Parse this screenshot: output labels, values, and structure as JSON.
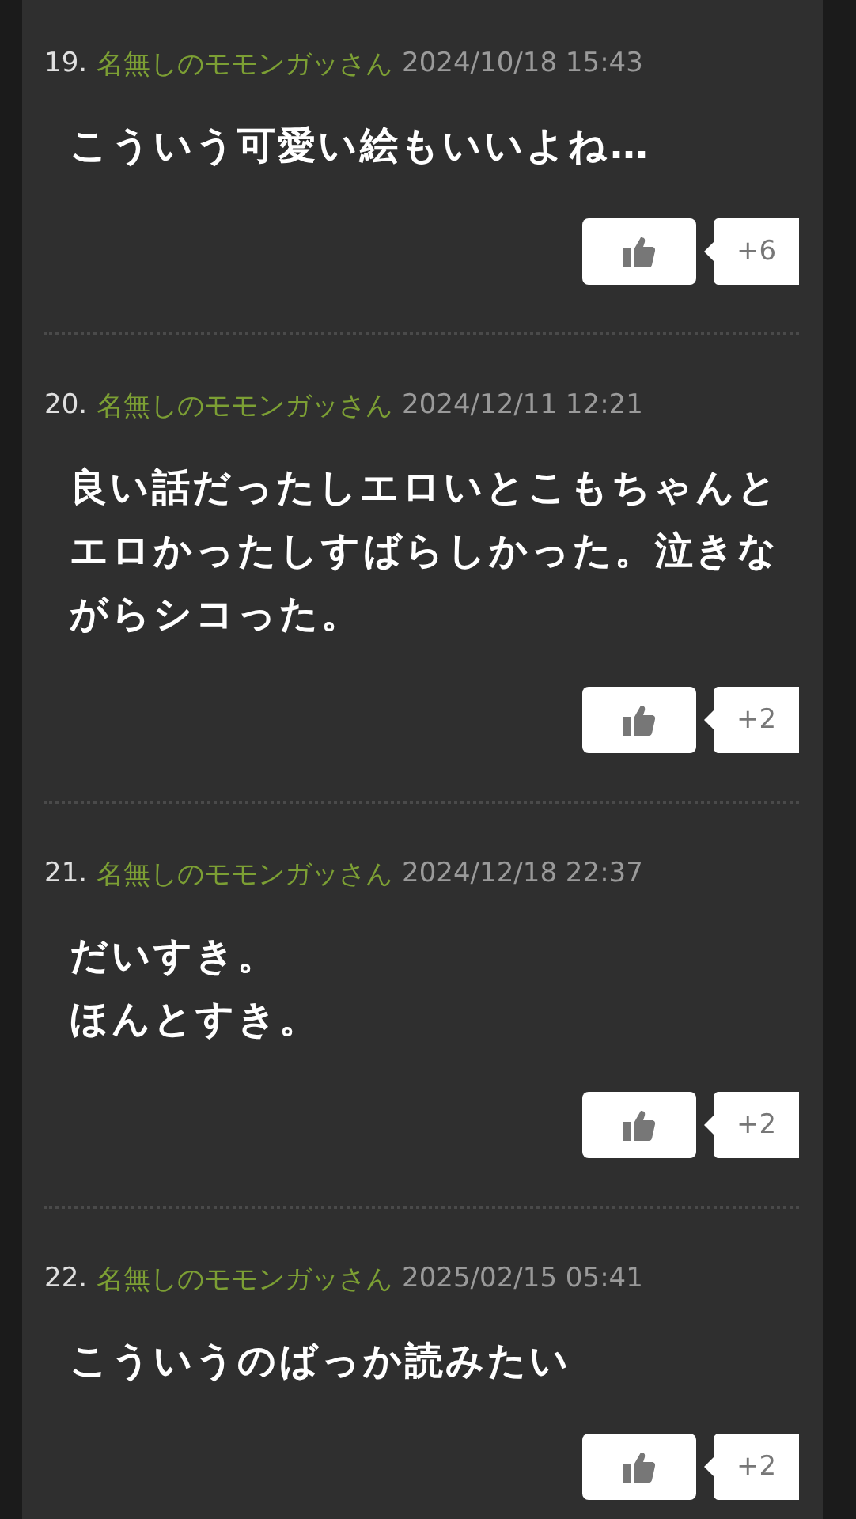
{
  "comments": [
    {
      "number": "19.",
      "name": "名無しのモモンガッさん",
      "date": "2024/10/18 15:43",
      "text": "こういう可愛い絵もいいよね…",
      "likes": "+6"
    },
    {
      "number": "20.",
      "name": "名無しのモモンガッさん",
      "date": "2024/12/11 12:21",
      "text": "良い話だったしエロいとこもちゃんとエロかったしすばらしかった。泣きながらシコった。",
      "likes": "+2"
    },
    {
      "number": "21.",
      "name": "名無しのモモンガッさん",
      "date": "2024/12/18 22:37",
      "text": "だいすき。",
      "text_line_2": "ほんとすき。",
      "likes": "+2"
    },
    {
      "number": "22.",
      "name": "名無しのモモンガッさん",
      "date": "2025/02/15 05:41",
      "text": "こういうのばっか読みたい",
      "likes": "+2"
    }
  ]
}
